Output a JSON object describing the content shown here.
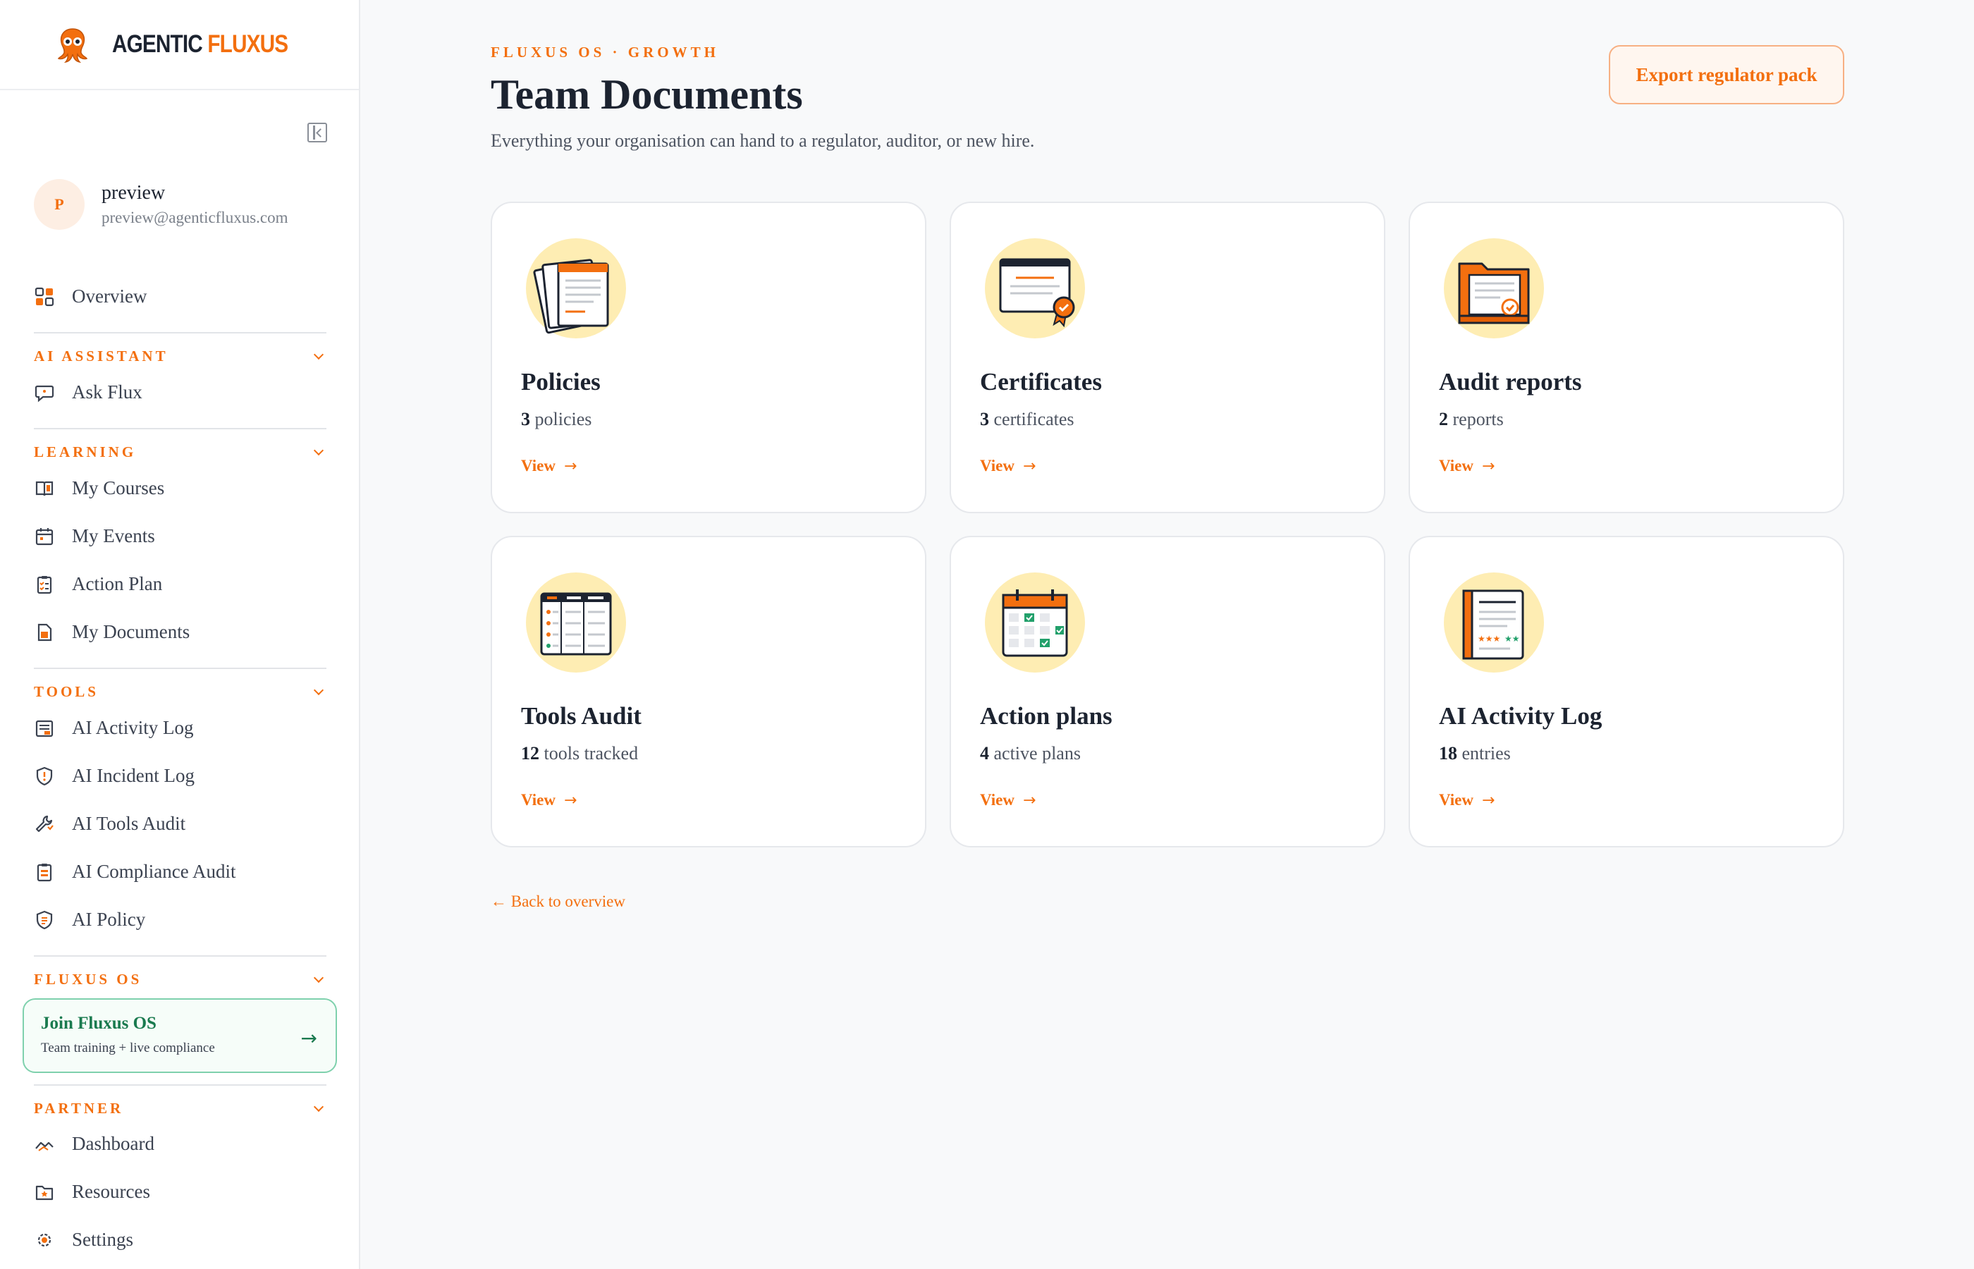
{
  "brand": {
    "part1": "AGENTIC ",
    "part2": "FLUXUS",
    "accent": "#f36f0f"
  },
  "user": {
    "initial": "P",
    "name": "preview",
    "email": "preview@agenticfluxus.com"
  },
  "nav": {
    "overview": "Overview",
    "sections": {
      "ai_assistant": "AI ASSISTANT",
      "learning": "LEARNING",
      "tools": "TOOLS",
      "fluxus_os": "FLUXUS OS",
      "partner": "PARTNER"
    },
    "ai_assistant_items": [
      "Ask Flux"
    ],
    "learning_items": [
      "My Courses",
      "My Events",
      "Action Plan",
      "My Documents"
    ],
    "tools_items": [
      "AI Activity Log",
      "AI Incident Log",
      "AI Tools Audit",
      "AI Compliance Audit",
      "AI Policy"
    ],
    "join": {
      "title": "Join Fluxus OS",
      "subtitle": "Team training + live compliance"
    },
    "partner_items": [
      "Dashboard",
      "Resources",
      "Settings"
    ]
  },
  "header": {
    "eyebrow": "FLUXUS OS · GROWTH",
    "title": "Team Documents",
    "subtitle": "Everything your organisation can hand to a regulator, auditor, or new hire.",
    "export_label": "Export regulator pack"
  },
  "cards": [
    {
      "title": "Policies",
      "count": "3",
      "unit": " policies",
      "view": "View",
      "icon": "policies-icon"
    },
    {
      "title": "Certificates",
      "count": "3",
      "unit": " certificates",
      "view": "View",
      "icon": "certificate-icon"
    },
    {
      "title": "Audit reports",
      "count": "2",
      "unit": " reports",
      "view": "View",
      "icon": "audit-folder-icon"
    },
    {
      "title": "Tools Audit",
      "count": "12",
      "unit": " tools tracked",
      "view": "View",
      "icon": "tools-table-icon"
    },
    {
      "title": "Action plans",
      "count": "4",
      "unit": " active plans",
      "view": "View",
      "icon": "calendar-check-icon"
    },
    {
      "title": "AI Activity Log",
      "count": "18",
      "unit": " entries",
      "view": "View",
      "icon": "log-book-icon"
    }
  ],
  "back_link": "← Back to overview",
  "colors": {
    "accent": "#f36f0f",
    "green": "#1a7a4f",
    "icon_bg": "#feedb3"
  }
}
